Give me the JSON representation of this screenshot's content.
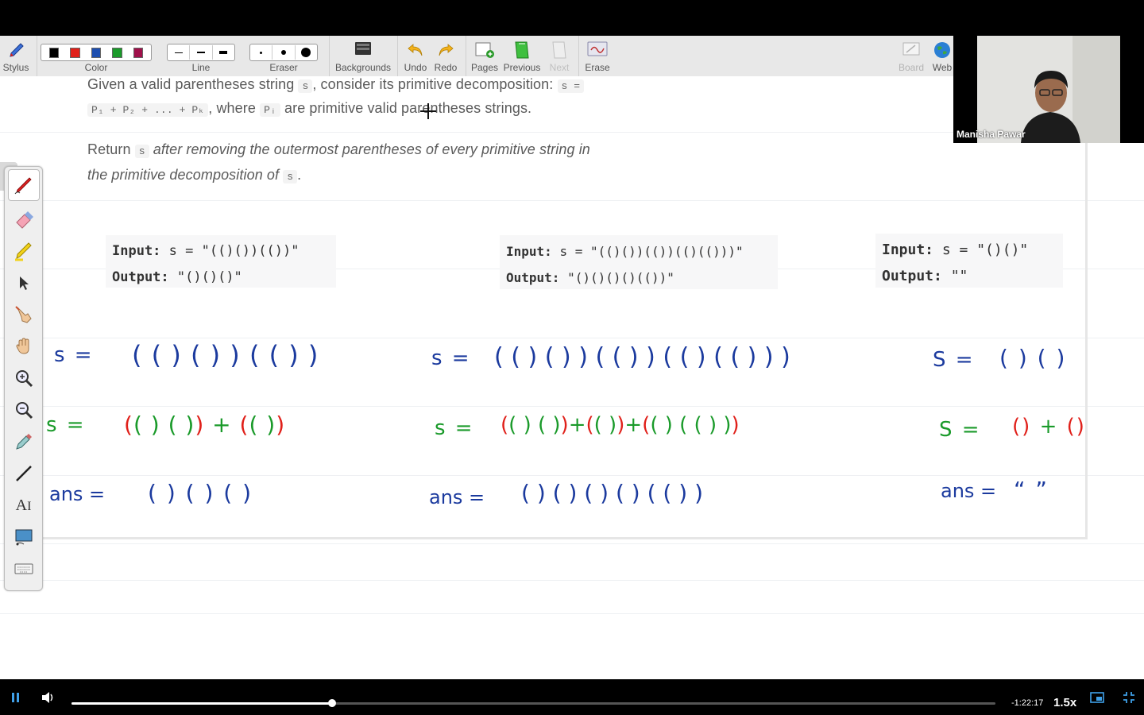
{
  "toolbar": {
    "stylus": "Stylus",
    "color": "Color",
    "line": "Line",
    "eraser": "Eraser",
    "backgrounds": "Backgrounds",
    "undo": "Undo",
    "redo": "Redo",
    "pages": "Pages",
    "previous": "Previous",
    "next": "Next",
    "erase": "Erase",
    "board": "Board",
    "web": "Web",
    "colors": [
      "#000000",
      "#e0201a",
      "#1e4fb0",
      "#1a9a2a",
      "#a0104a"
    ]
  },
  "problem": {
    "line1_a": "Given a valid parentheses string",
    "line1_code1": "s",
    "line1_b": ", consider its primitive decomposition:",
    "line1_code2": "s =",
    "line2_code": "P₁ + P₂ + ... + Pₖ",
    "line2_a": ", where",
    "line2_code2": "Pᵢ",
    "line2_b": "are primitive valid parentheses strings.",
    "line3_a": "Return",
    "line3_code": "s",
    "line3_b": "after removing the outermost parentheses of every primitive string in",
    "line4_a": "the primitive decomposition of",
    "line4_code": "s",
    "line4_b": "."
  },
  "examples": [
    {
      "input_label": "Input:",
      "input_value": "s = \"(()())(())\"",
      "output_label": "Output:",
      "output_value": "\"()()()\""
    },
    {
      "input_label": "Input:",
      "input_value": "s = \"(()())(())(()(()))\"",
      "output_label": "Output:",
      "output_value": "\"()()()()(())\""
    },
    {
      "input_label": "Input:",
      "input_value": "s = \"()()\"",
      "output_label": "Output:",
      "output_value": "\"\""
    }
  ],
  "handwriting": {
    "col1": {
      "s_label": "s =",
      "s_value": "( ( ) ( ) ) ( ( ) )",
      "split_label": "s =",
      "split_parts": [
        "(",
        "( ) ( )",
        ")",
        " + ",
        "(",
        "( )",
        ")"
      ],
      "ans_label": "ans =",
      "ans_value": "( ) ( ) ( )"
    },
    "col2": {
      "s_label": "s =",
      "s_value": "( ( ) ( ) ) ( ( ) ) ( ( ) ( ( ) ) )",
      "split_label": "s =",
      "split_parts": [
        "(",
        "( ) ( )",
        ")",
        "+",
        "(",
        "( )",
        ")",
        "+",
        "(",
        "( ) ( ( ) )",
        ")"
      ],
      "ans_label": "ans =",
      "ans_value": "( ) ( ) ( ) ( ) ( ( ) )"
    },
    "col3": {
      "s_label": "S =",
      "s_value": "( ) ( )",
      "split_label": "S =",
      "split_parts": [
        "(",
        ")",
        " + ",
        "(",
        ")"
      ],
      "ans_label": "ans =",
      "ans_value": "“ ”"
    }
  },
  "webcam": {
    "name": "Manisha Pawar"
  },
  "player": {
    "time_remaining": "-1:22:17",
    "speed": "1.5x",
    "progress": 0.282
  }
}
